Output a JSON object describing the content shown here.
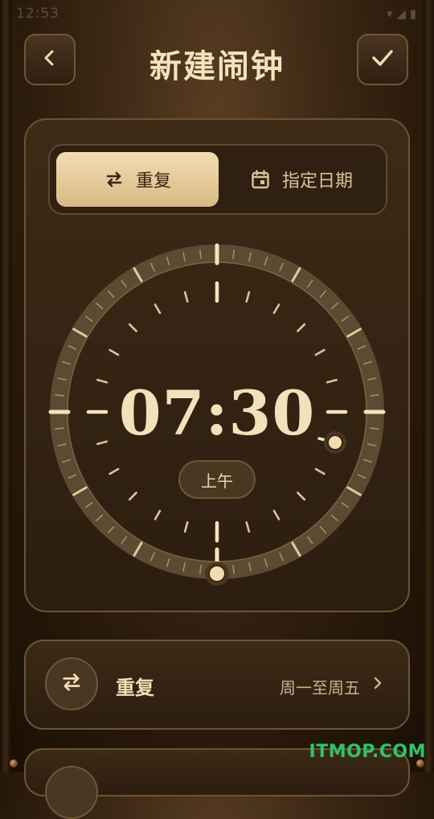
{
  "status_bar": {
    "time": "12:53",
    "icons": "▾ ◢ ▮"
  },
  "header": {
    "title": "新建闹钟"
  },
  "mode_tabs": [
    {
      "label": "重复",
      "icon": "repeat-icon",
      "selected": true
    },
    {
      "label": "指定日期",
      "icon": "calendar-icon",
      "selected": false
    }
  ],
  "clock": {
    "time": "07:30",
    "period": "上午",
    "hour": 7,
    "minute": 30
  },
  "repeat_row": {
    "label": "重复",
    "value": "周一至周五"
  },
  "watermark": "ITMOP.COM",
  "colors": {
    "accent": "#f2ddb0",
    "card": "#35240f",
    "border": "#6a5434",
    "watermark": "#2ec46a"
  }
}
